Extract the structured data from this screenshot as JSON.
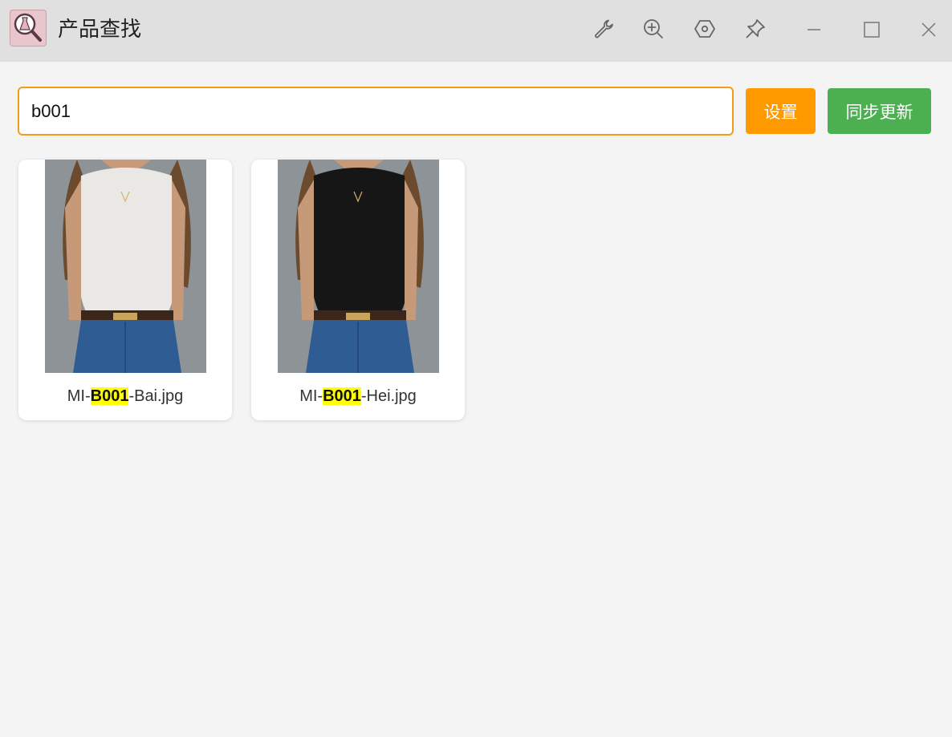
{
  "app": {
    "title": "产品查找",
    "icon": "dress-search-icon"
  },
  "toolbar": {
    "icons": [
      "wrench-icon",
      "zoom-in-icon",
      "hexagon-settings-icon",
      "pin-icon",
      "minimize-icon",
      "maximize-icon",
      "close-icon"
    ]
  },
  "search": {
    "value": "b001",
    "accent": "#f29d12"
  },
  "buttons": {
    "settings_label": "设置",
    "sync_label": "同步更新",
    "settings_color": "#ff9900",
    "sync_color": "#4caf50"
  },
  "results": [
    {
      "prefix": "MI-",
      "highlight": "B001",
      "suffix": "-Bai.jpg",
      "top_color": "white"
    },
    {
      "prefix": "MI-",
      "highlight": "B001",
      "suffix": "-Hei.jpg",
      "top_color": "black"
    }
  ]
}
